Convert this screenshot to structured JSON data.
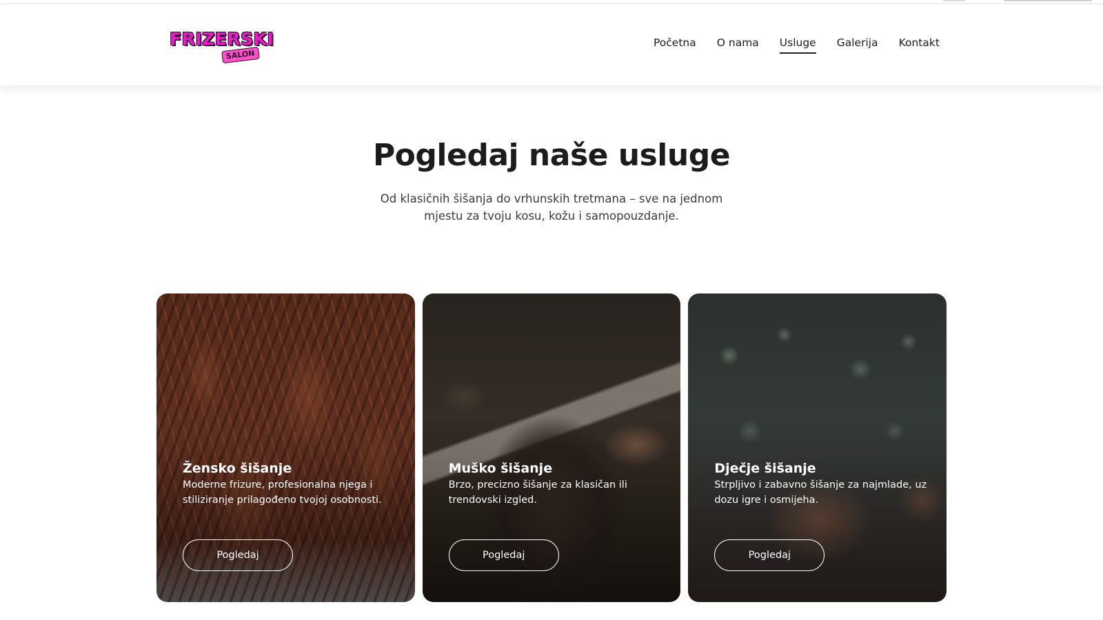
{
  "header": {
    "logo": {
      "main": "FRIZERSKI",
      "sub": "SALON"
    },
    "nav": [
      {
        "label": "Početna",
        "active": false
      },
      {
        "label": "O nama",
        "active": false
      },
      {
        "label": "Usluge",
        "active": true
      },
      {
        "label": "Galerija",
        "active": false
      },
      {
        "label": "Kontakt",
        "active": false
      }
    ]
  },
  "services": {
    "title": "Pogledaj naše usluge",
    "subtitle": "Od klasičnih šišanja do vrhunskih tretmana – sve na jednom mjestu za tvoju kosu, kožu i samopouzdanje.",
    "cards": [
      {
        "title": "Žensko šišanje",
        "description": "Moderne frizure, profesionalna njega i stiliziranje prilagođeno tvojoj osobnosti.",
        "button": "Pogledaj"
      },
      {
        "title": "Muško šišanje",
        "description": "Brzo, precizno šišanje za klasičan ili trendovski izgled.",
        "button": "Pogledaj"
      },
      {
        "title": "Dječje šišanje",
        "description": "Strpljivo i zabavno šišanje za najmlade, uz dozu igre i osmijeha.",
        "button": "Pogledaj"
      }
    ]
  },
  "colors": {
    "brand_pink": "#e51fc6",
    "text_dark": "#1c1c1c",
    "background": "#ffffff"
  }
}
